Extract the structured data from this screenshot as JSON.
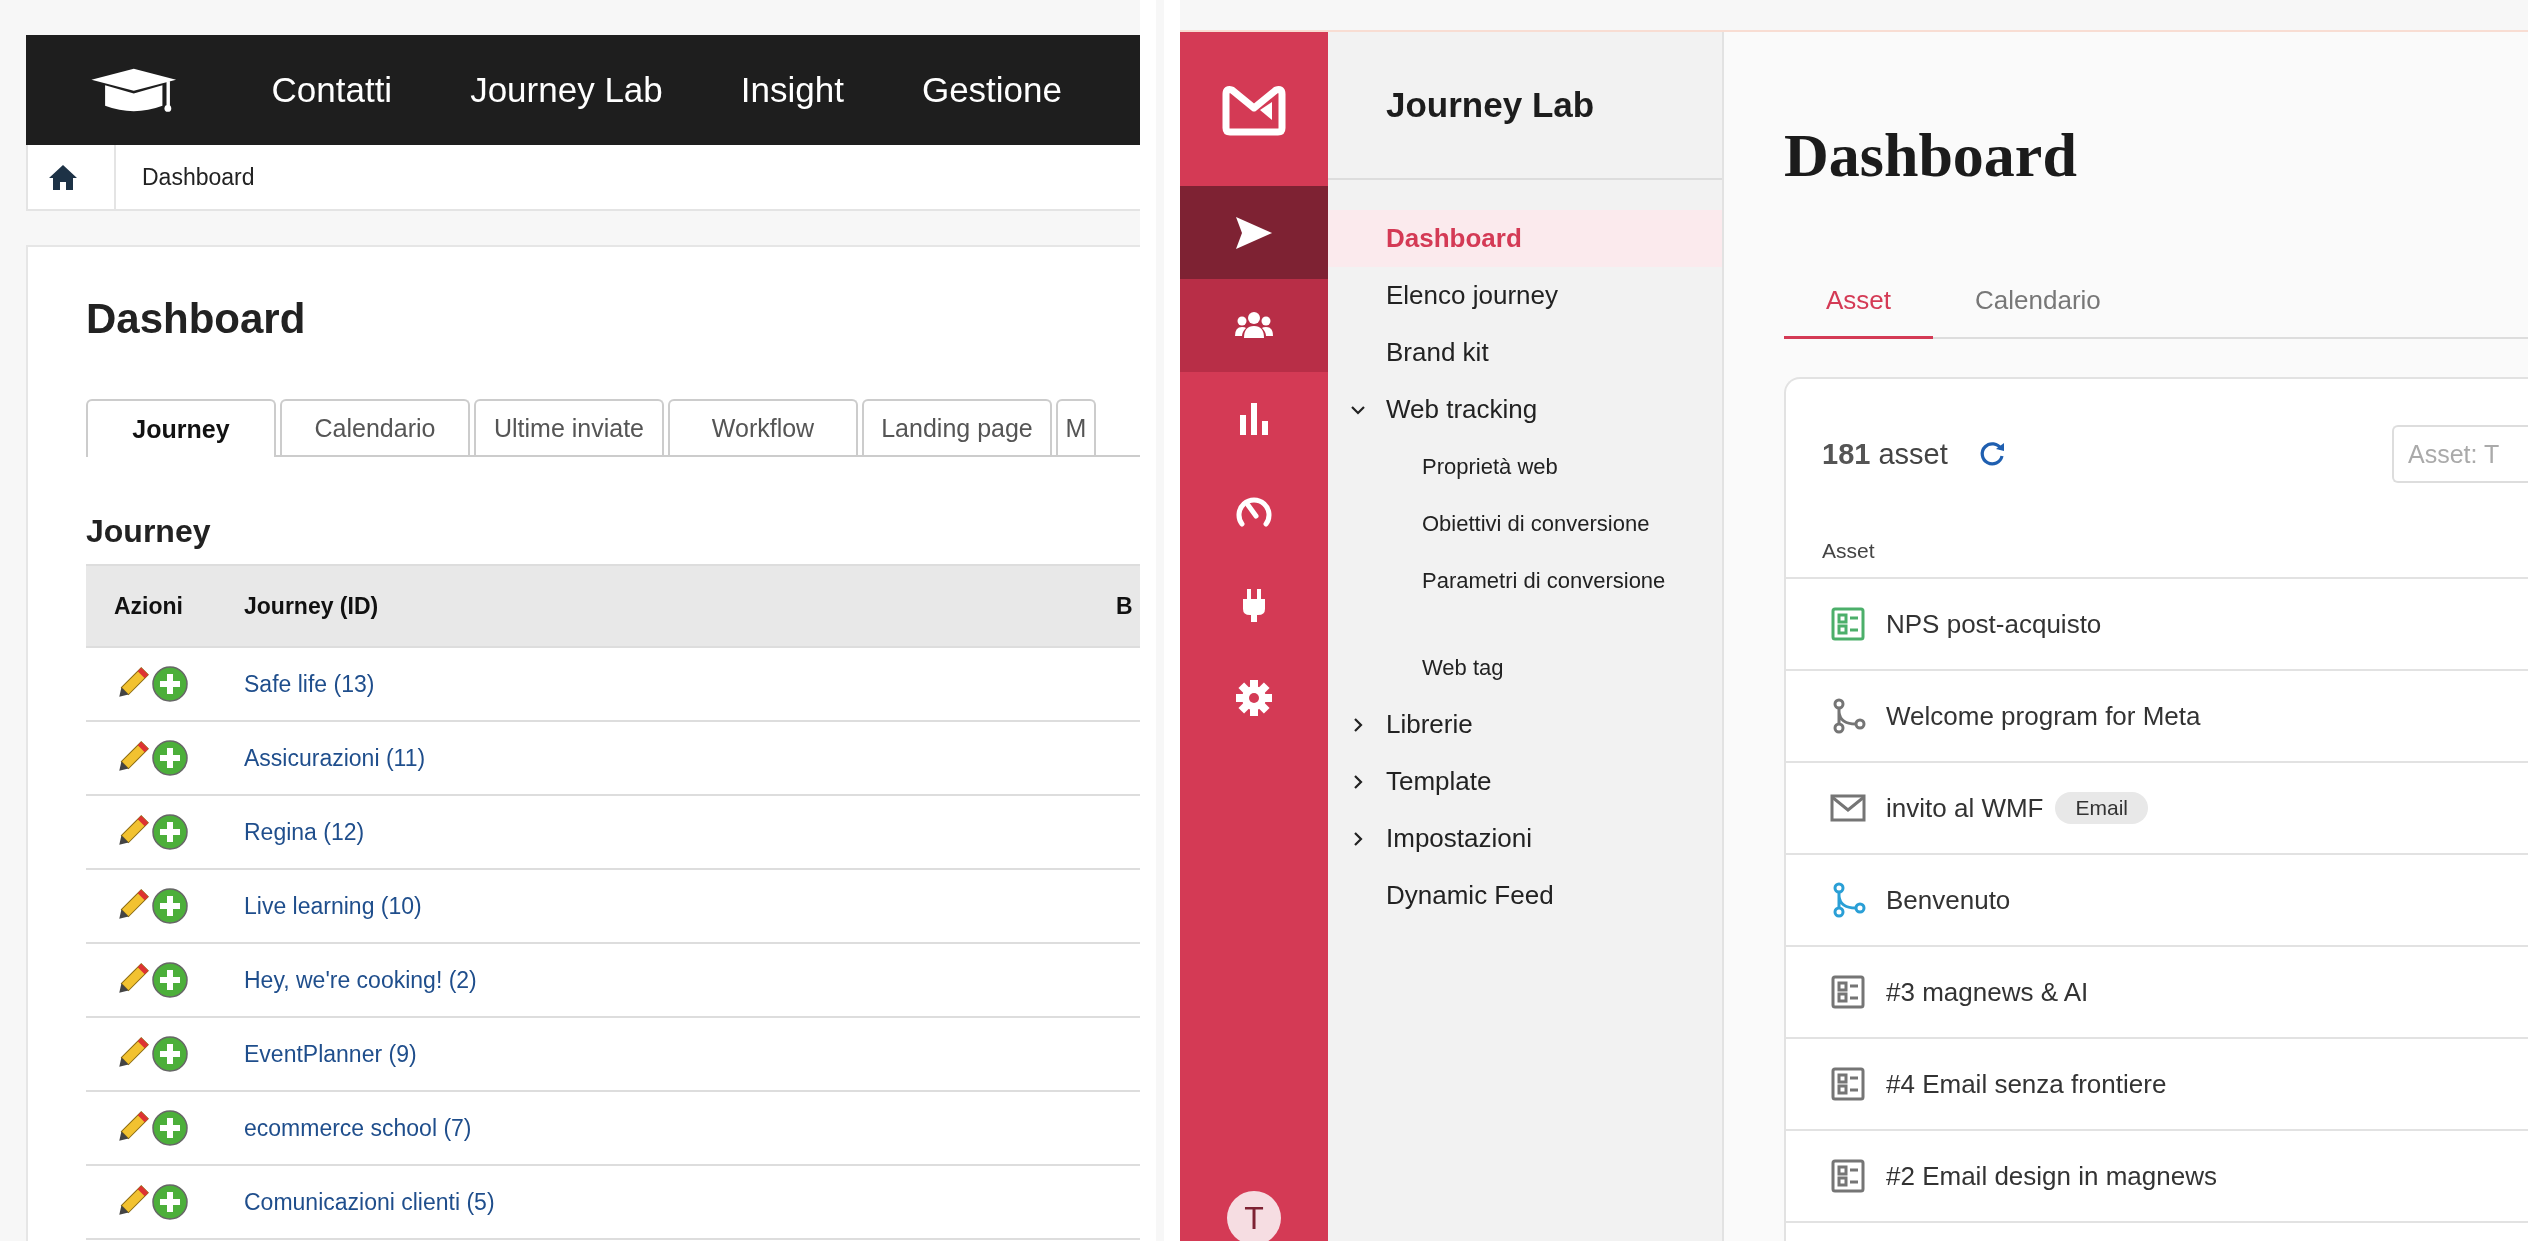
{
  "old_app": {
    "nav": {
      "items": [
        "Contatti",
        "Journey Lab",
        "Insight",
        "Gestione"
      ]
    },
    "breadcrumb": {
      "items": [
        "Dashboard"
      ]
    },
    "title": "Dashboard",
    "tabs": [
      {
        "label": "Journey",
        "selected": true
      },
      {
        "label": "Calendario",
        "selected": false
      },
      {
        "label": "Ultime inviate",
        "selected": false
      },
      {
        "label": "Workflow",
        "selected": false
      },
      {
        "label": "Landing page",
        "selected": false
      },
      {
        "label": "M",
        "selected": false
      }
    ],
    "section_title": "Journey",
    "table": {
      "columns": [
        "Azioni",
        "Journey (ID)",
        "B"
      ],
      "rows": [
        {
          "name": "Safe life (13)"
        },
        {
          "name": "Assicurazioni (11)"
        },
        {
          "name": "Regina (12)"
        },
        {
          "name": "Live learning (10)"
        },
        {
          "name": "Hey, we're cooking! (2)"
        },
        {
          "name": "EventPlanner (9)"
        },
        {
          "name": "ecommerce school (7)"
        },
        {
          "name": "Comunicazioni clienti (5)"
        }
      ]
    }
  },
  "new_app": {
    "rail": {
      "items": [
        {
          "kind": "send",
          "selected": true,
          "hovered": false
        },
        {
          "kind": "users",
          "selected": false,
          "hovered": true
        },
        {
          "kind": "chart",
          "selected": false,
          "hovered": false
        },
        {
          "kind": "gauge",
          "selected": false,
          "hovered": false
        },
        {
          "kind": "plug",
          "selected": false,
          "hovered": false
        },
        {
          "kind": "settings",
          "selected": false,
          "hovered": false
        }
      ],
      "avatar": "T"
    },
    "sidebar": {
      "title": "Journey Lab",
      "items": [
        {
          "label": "Dashboard",
          "kind": "link",
          "selected": true
        },
        {
          "label": "Elenco journey",
          "kind": "link",
          "selected": false
        },
        {
          "label": "Brand kit",
          "kind": "link",
          "selected": false
        },
        {
          "label": "Web tracking",
          "kind": "group",
          "selected": false,
          "expanded": true,
          "children": [
            {
              "label": "Proprietà web",
              "selected": false
            },
            {
              "label": "Obiettivi di conversione",
              "selected": false
            },
            {
              "label": "Parametri di conversione",
              "selected": false
            },
            {
              "label": "Web tag",
              "selected": false
            }
          ]
        },
        {
          "label": "Librerie",
          "kind": "group",
          "selected": false,
          "expanded": false
        },
        {
          "label": "Template",
          "kind": "group",
          "selected": false,
          "expanded": false
        },
        {
          "label": "Impostazioni",
          "kind": "group",
          "selected": false,
          "expanded": false
        },
        {
          "label": "Dynamic Feed",
          "kind": "link",
          "selected": false
        }
      ]
    },
    "main": {
      "title": "Dashboard",
      "tabs": [
        {
          "label": "Asset",
          "selected": true
        },
        {
          "label": "Calendario",
          "selected": false
        }
      ],
      "count": "**181** asset",
      "search": {
        "placeholder": "Asset: T"
      },
      "table": {
        "columns": [
          "Asset"
        ],
        "rows": [
          {
            "name": "NPS post-acquisto",
            "kind": "form",
            "color": "#4caf6a"
          },
          {
            "name": "Welcome program for Meta",
            "kind": "journey",
            "color": "#757575"
          },
          {
            "name": "invito al WMF",
            "kind": "email",
            "color": "#757575",
            "badge": "Email"
          },
          {
            "name": "Benvenuto",
            "kind": "journey",
            "color": "#2a9fd6"
          },
          {
            "name": "#3 magnews & AI",
            "kind": "form",
            "color": "#757575"
          },
          {
            "name": "#4 Email senza frontiere",
            "kind": "form",
            "color": "#757575"
          },
          {
            "name": "#2 Email design in magnews",
            "kind": "form",
            "color": "#757575"
          }
        ]
      }
    }
  }
}
